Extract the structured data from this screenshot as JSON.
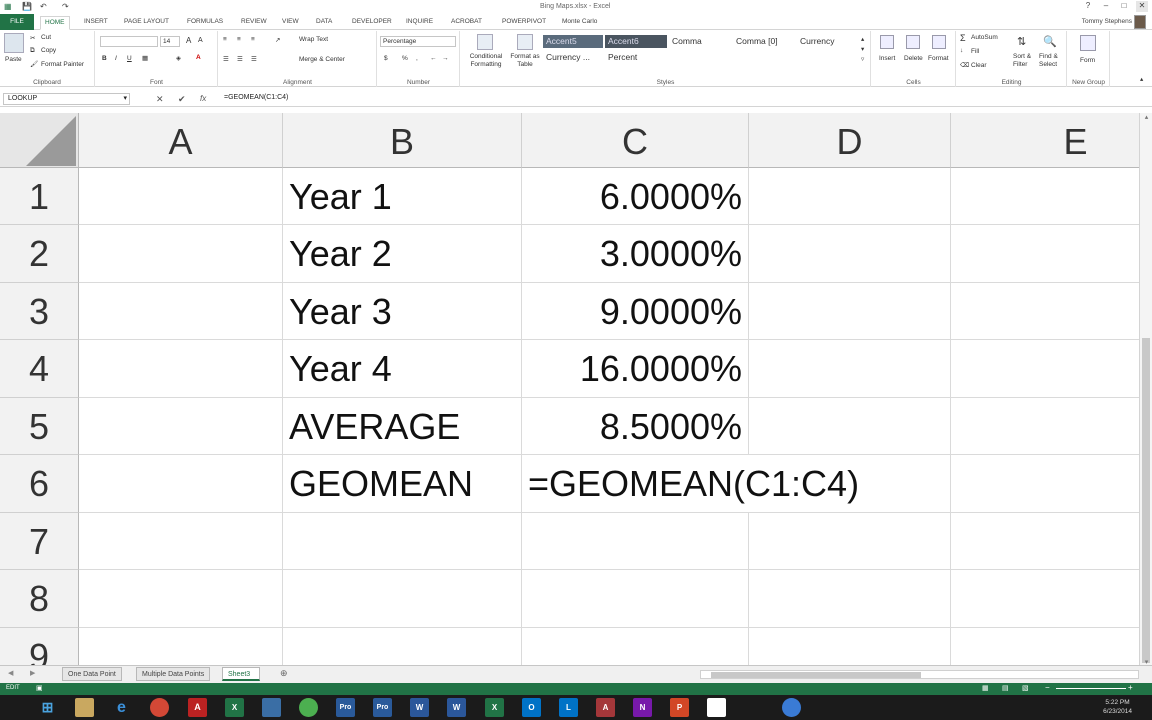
{
  "window": {
    "doc_title": "Bing Maps.xlsx - Excel",
    "user_name": "Tommy Stephens",
    "min": "–",
    "restore": "□",
    "close": "✕",
    "help": "?"
  },
  "tabs": [
    "FILE",
    "HOME",
    "INSERT",
    "PAGE LAYOUT",
    "FORMULAS",
    "REVIEW",
    "VIEW",
    "DATA",
    "DEVELOPER",
    "INQUIRE",
    "ACROBAT",
    "POWERPIVOT",
    "Monte Carlo"
  ],
  "ribbon": {
    "clipboard": {
      "paste": "Paste",
      "cut": "Cut",
      "copy": "Copy",
      "format_painter": "Format Painter",
      "label": "Clipboard"
    },
    "font": {
      "size": "14",
      "bold": "B",
      "italic": "I",
      "underline": "U",
      "grow": "A",
      "shrink": "A",
      "label": "Font"
    },
    "alignment": {
      "wrap": "Wrap Text",
      "merge": "Merge & Center",
      "label": "Alignment"
    },
    "number": {
      "format": "Percentage",
      "currency": "$",
      "percent": "%",
      "comma": ",",
      "label": "Number"
    },
    "styles": {
      "conditional": "Conditional Formatting",
      "format_table": "Format as Table",
      "cells": [
        "Accent5",
        "Accent6",
        "Comma",
        "Comma [0]",
        "Currency",
        "Currency ...",
        "Percent"
      ],
      "label": "Styles"
    },
    "cells_group": {
      "insert": "Insert",
      "delete": "Delete",
      "format": "Format",
      "label": "Cells"
    },
    "editing": {
      "autosum": "AutoSum",
      "fill": "Fill",
      "clear": "Clear",
      "sort": "Sort & Filter",
      "find": "Find & Select",
      "label": "Editing"
    },
    "new_group": {
      "form": "Form",
      "label": "New Group"
    }
  },
  "formula_bar": {
    "name_box": "LOOKUP",
    "cancel": "✕",
    "enter": "✔",
    "fx": "fx",
    "formula": "=GEOMEAN(C1:C4)"
  },
  "grid": {
    "columns": [
      "A",
      "B",
      "C",
      "D",
      "E"
    ],
    "rows": [
      "1",
      "2",
      "3",
      "4",
      "5",
      "6",
      "7",
      "8",
      "9"
    ],
    "cells": {
      "B1": "Year 1",
      "C1": "6.0000%",
      "B2": "Year 2",
      "C2": "3.0000%",
      "B3": "Year 3",
      "C3": "9.0000%",
      "B4": "Year 4",
      "C4": "16.0000%",
      "B5": "AVERAGE",
      "C5": "8.5000%",
      "B6": "GEOMEAN",
      "C6": "=GEOMEAN(C1:C4)"
    }
  },
  "sheets": [
    "One Data Point",
    "Multiple Data Points",
    "Sheet3"
  ],
  "status": {
    "mode": "EDIT"
  },
  "taskbar": {
    "icons": [
      "Start",
      "Explorer",
      "Folder",
      "IE",
      "Chrome",
      "Acrobat",
      "Excel",
      "Tool",
      "Pro 13",
      "Pro 12",
      "W",
      "W",
      "X",
      "O",
      "Lync",
      "A",
      "N",
      "P",
      "Notes",
      "Help"
    ],
    "time": "5:22 PM",
    "date": "6/23/2014"
  }
}
